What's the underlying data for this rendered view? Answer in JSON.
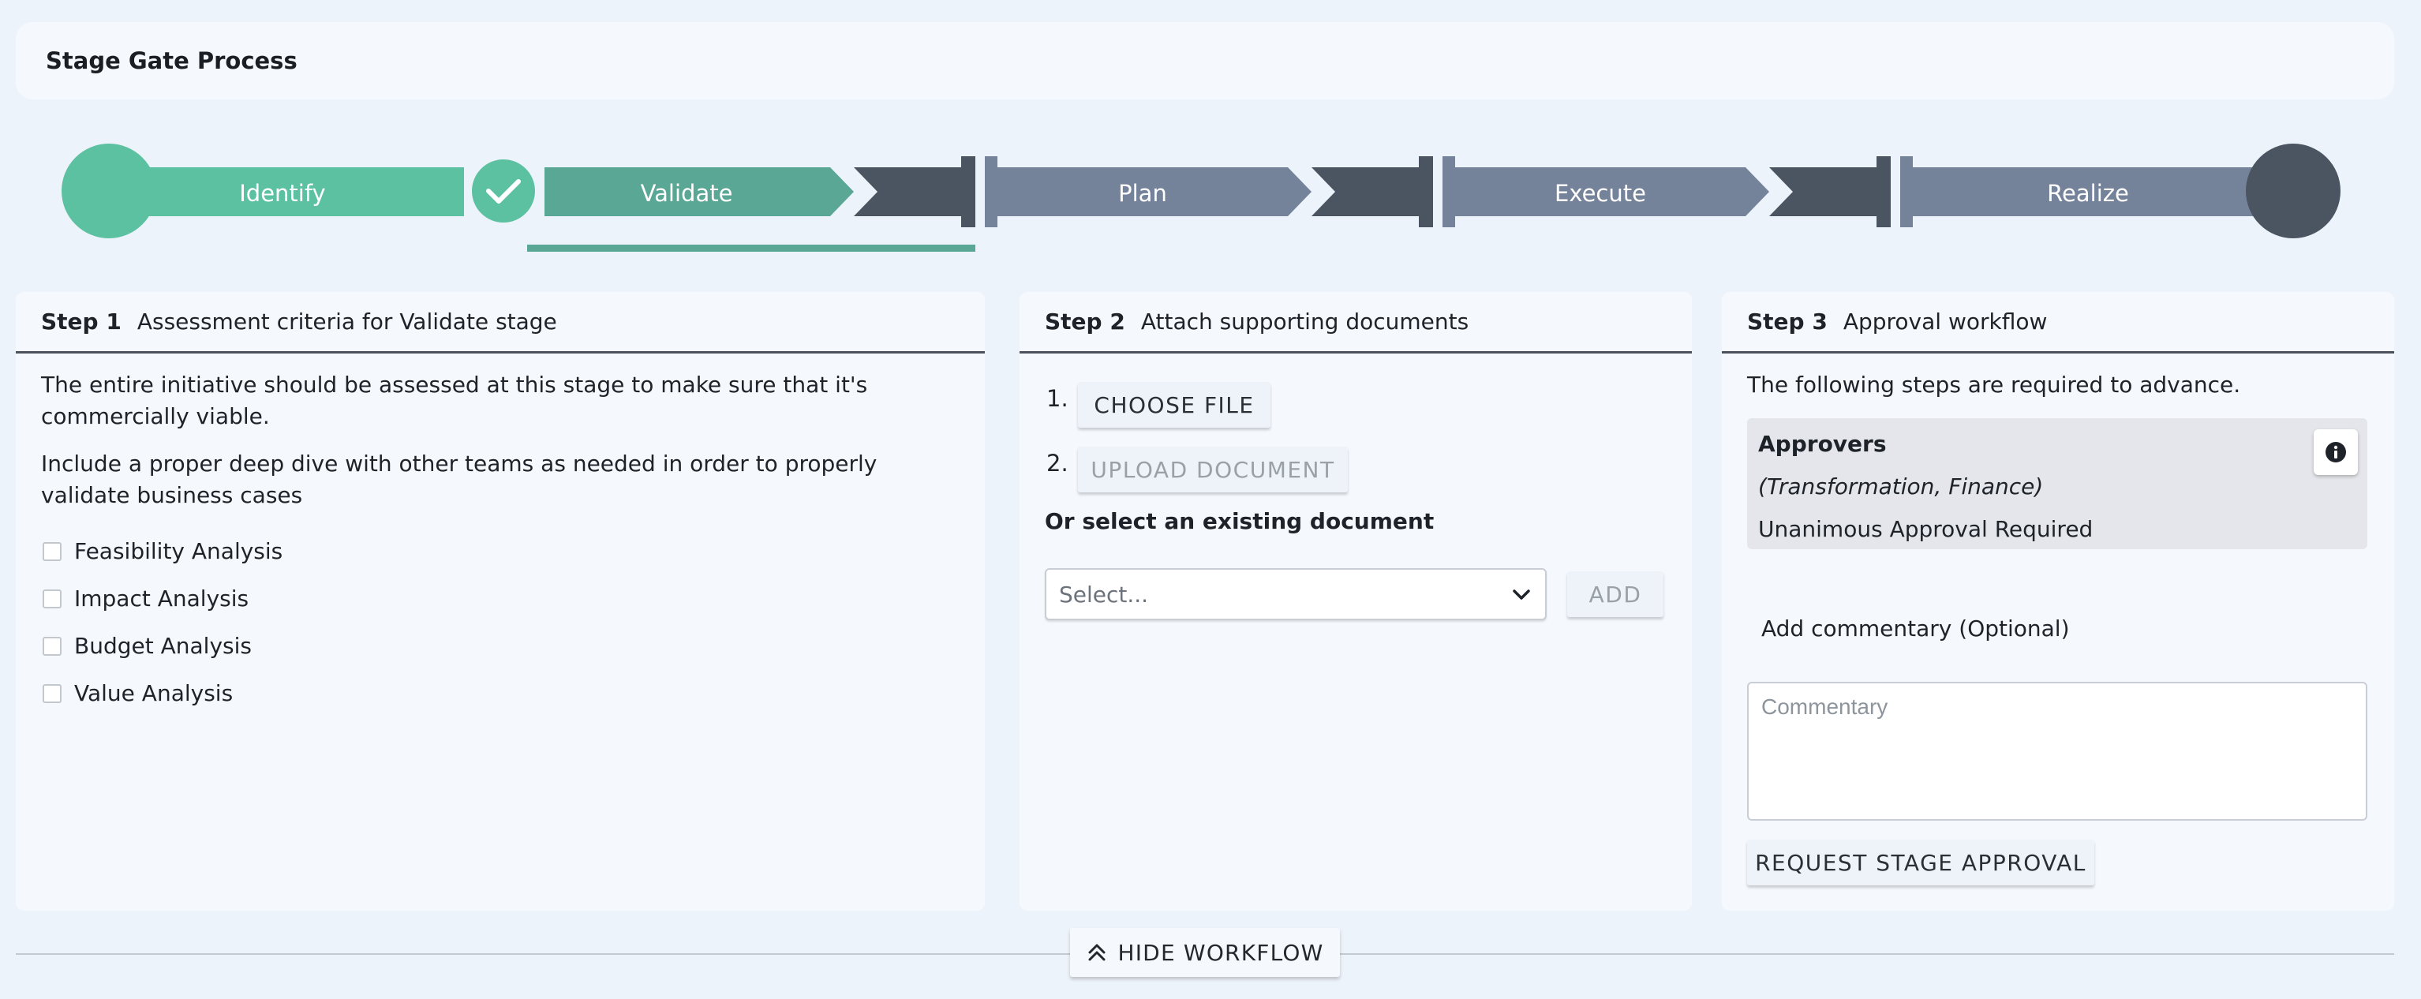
{
  "header": {
    "title": "Stage Gate Process"
  },
  "stages": [
    {
      "label": "Identify",
      "status": "completed"
    },
    {
      "label": "Validate",
      "status": "current"
    },
    {
      "label": "Plan",
      "status": "upcoming"
    },
    {
      "label": "Execute",
      "status": "upcoming"
    },
    {
      "label": "Realize",
      "status": "upcoming"
    }
  ],
  "colors": {
    "completed": "#5cc1a1",
    "current": "#5ba796",
    "upcoming": "#75839a",
    "gate": "#4b5461",
    "background": "#edf3fb",
    "card": "#f5f9fe"
  },
  "step1": {
    "number": "Step 1",
    "title": "Assessment criteria for Validate stage",
    "paragraph1": "The entire initiative should be assessed at this stage to make sure that it's commercially viable.",
    "paragraph2": "Include a proper deep dive with other teams as needed in order to properly validate business cases",
    "checklist": [
      "Feasibility Analysis",
      "Impact Analysis",
      "Budget Analysis",
      "Value Analysis"
    ]
  },
  "step2": {
    "number": "Step 2",
    "title": "Attach supporting documents",
    "item1_number": "1.",
    "choose_file_label": "CHOOSE FILE",
    "item2_number": "2.",
    "upload_label": "UPLOAD DOCUMENT",
    "existing_label": "Or select an existing document",
    "select_placeholder": "Select...",
    "add_label": "ADD"
  },
  "step3": {
    "number": "Step 3",
    "title": "Approval workflow",
    "intro": "The following steps are required to advance.",
    "approvers_title": "Approvers",
    "approvers_groups": "(Transformation, Finance)",
    "approval_rule": "Unanimous Approval Required",
    "commentary_label": "Add commentary (Optional)",
    "commentary_placeholder": "Commentary",
    "request_label": "REQUEST STAGE APPROVAL"
  },
  "footer": {
    "hide_label": "HIDE WORKFLOW"
  }
}
